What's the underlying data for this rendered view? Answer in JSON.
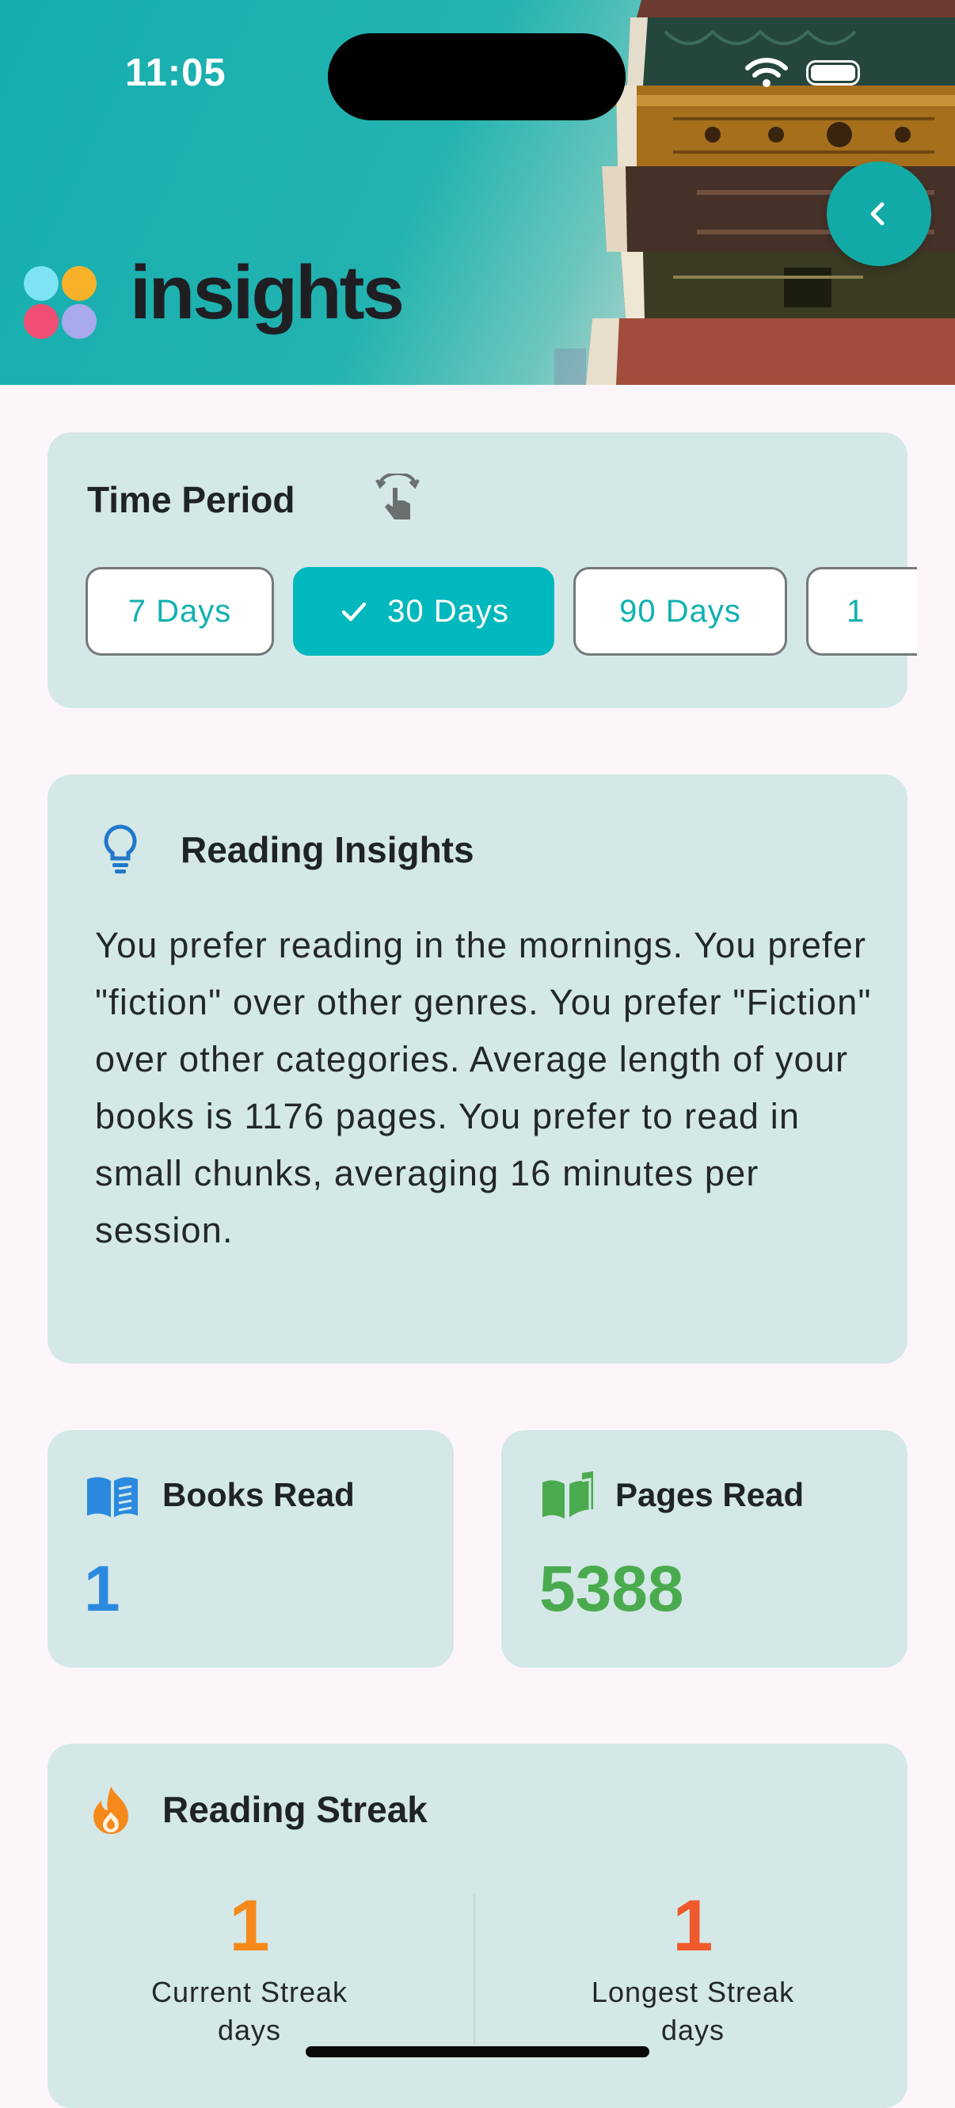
{
  "status_bar": {
    "time": "11:05"
  },
  "header": {
    "app_title": "insights",
    "back_icon": "chevron-left-icon"
  },
  "time_period": {
    "title": "Time Period",
    "hint_icon": "swipe-hint-icon",
    "options": [
      "7 Days",
      "30 Days",
      "90 Days",
      "1"
    ],
    "selected": "30 Days"
  },
  "insights": {
    "title": "Reading Insights",
    "icon": "lightbulb-icon",
    "text": "You prefer reading in the mornings. You prefer \"fiction\" over other genres. You prefer \"Fiction\" over other categories. Average length of your books is 1176 pages. You prefer to read in small chunks, averaging 16 minutes per session."
  },
  "stats": {
    "books_read": {
      "label": "Books Read",
      "value": "1",
      "icon": "open-book-icon",
      "color": "#2b8ae0"
    },
    "pages_read": {
      "label": "Pages Read",
      "value": "5388",
      "icon": "book-pages-icon",
      "color": "#4aab4e"
    }
  },
  "streak": {
    "title": "Reading Streak",
    "icon": "flame-icon",
    "current": {
      "value": "1",
      "label": "Current Streak",
      "unit": "days"
    },
    "longest": {
      "value": "1",
      "label": "Longest Streak",
      "unit": "days"
    },
    "current_color": "#f5891b",
    "longest_color": "#ee5a2b"
  },
  "colors": {
    "accent": "#00b8bd",
    "card_bg": "#d4e8e7",
    "page_bg": "#fcf6fb"
  }
}
